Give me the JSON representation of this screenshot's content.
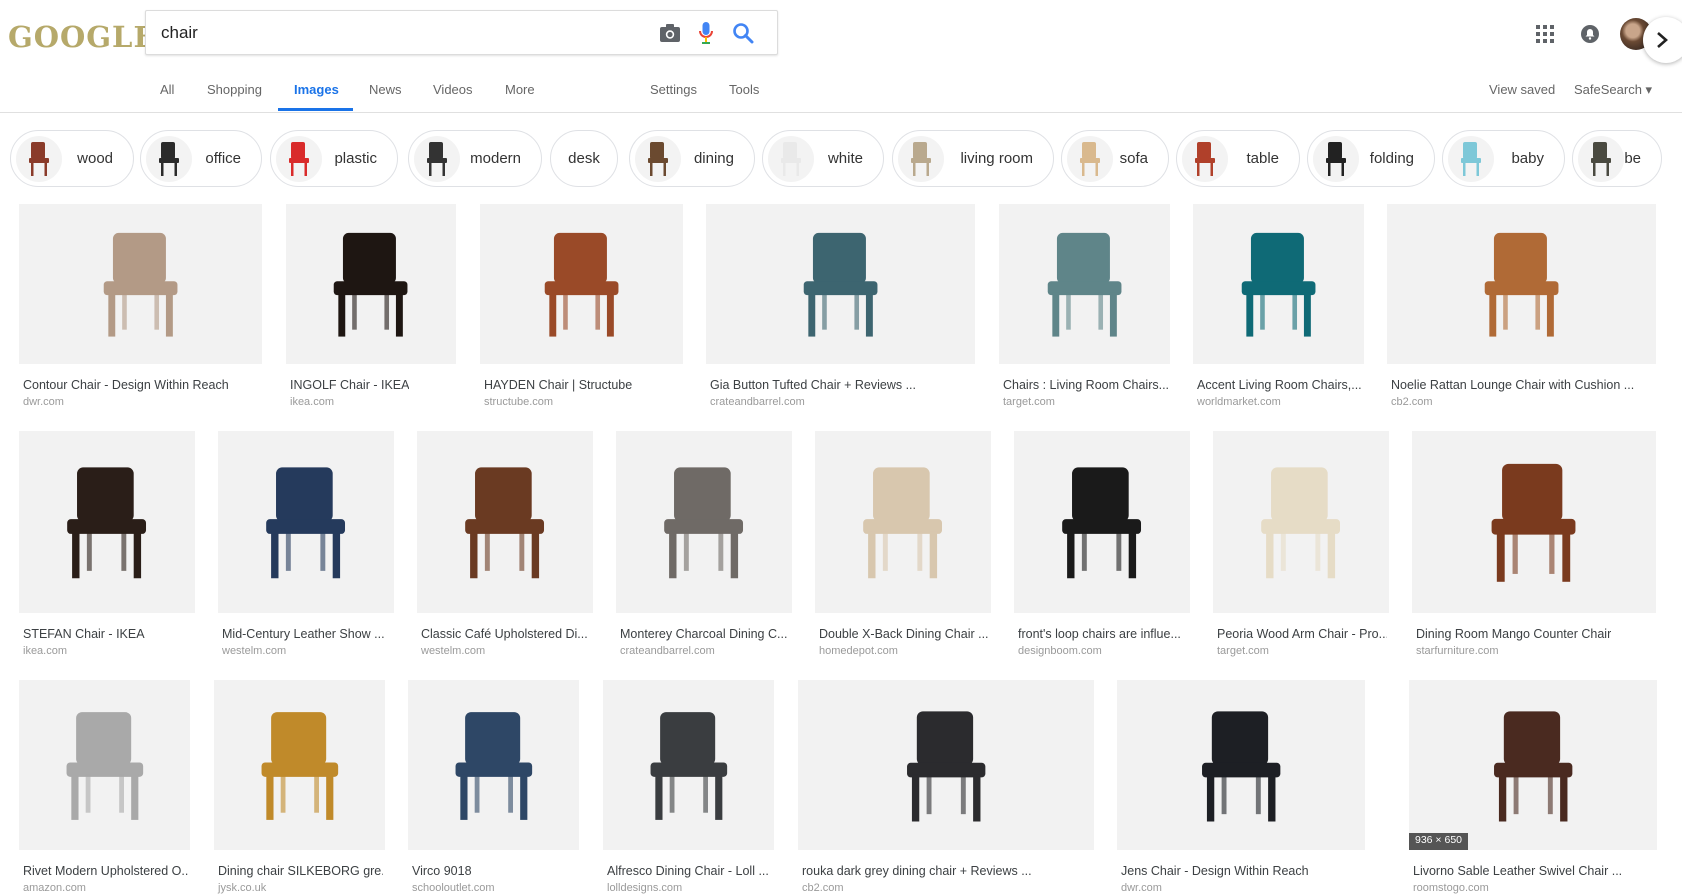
{
  "logo": "GOOGLE",
  "search": {
    "value": "chair",
    "placeholder": ""
  },
  "search_icons": [
    "camera-icon",
    "microphone-icon",
    "search-icon"
  ],
  "header_icons": [
    "apps-grid-icon",
    "notifications-icon",
    "account-avatar"
  ],
  "nav": {
    "tabs": [
      "All",
      "Shopping",
      "Images",
      "News",
      "Videos",
      "More"
    ],
    "active": "Images",
    "settings": "Settings",
    "tools": "Tools",
    "view_saved": "View saved",
    "safesearch": "SafeSearch ▾"
  },
  "chips": [
    {
      "label": "wood",
      "color": "#8a3b2a"
    },
    {
      "label": "office",
      "color": "#2b2b2b"
    },
    {
      "label": "plastic",
      "color": "#d92b2b"
    },
    {
      "label": "modern",
      "color": "#333333"
    },
    {
      "label": "desk",
      "color": ""
    },
    {
      "label": "dining",
      "color": "#6b4a30"
    },
    {
      "label": "white",
      "color": "#e9e9e9"
    },
    {
      "label": "living room",
      "color": "#b9a98e"
    },
    {
      "label": "sofa",
      "color": "#d9b98e"
    },
    {
      "label": "table",
      "color": "#b0402a"
    },
    {
      "label": "folding",
      "color": "#222222"
    },
    {
      "label": "baby",
      "color": "#7ec8d8"
    },
    {
      "label": "be",
      "color": "#4a4a40"
    }
  ],
  "results": [
    {
      "title": "Contour Chair - Design Within Reach",
      "source": "dwr.com",
      "color": "#b39a86"
    },
    {
      "title": "INGOLF Chair - IKEA",
      "source": "ikea.com",
      "color": "#1e1612"
    },
    {
      "title": "HAYDEN Chair | Structube",
      "source": "structube.com",
      "color": "#9a4a28"
    },
    {
      "title": "Gia Button Tufted Chair + Reviews ...",
      "source": "crateandbarrel.com",
      "color": "#3d6570"
    },
    {
      "title": "Chairs : Living Room Chairs...",
      "source": "target.com",
      "color": "#5f8589"
    },
    {
      "title": "Accent Living Room Chairs,...",
      "source": "worldmarket.com",
      "color": "#0f6a76"
    },
    {
      "title": "Noelie Rattan Lounge Chair with Cushion ...",
      "source": "cb2.com",
      "color": "#b06a36"
    },
    {
      "title": "STEFAN Chair - IKEA",
      "source": "ikea.com",
      "color": "#2a1e18"
    },
    {
      "title": "Mid-Century Leather Show ...",
      "source": "westelm.com",
      "color": "#253a5c"
    },
    {
      "title": "Classic Café Upholstered Di...",
      "source": "westelm.com",
      "color": "#6a3a22"
    },
    {
      "title": "Monterey Charcoal Dining C...",
      "source": "crateandbarrel.com",
      "color": "#6f6a66"
    },
    {
      "title": "Double X-Back Dining Chair ...",
      "source": "homedepot.com",
      "color": "#d8c7ae"
    },
    {
      "title": "front's loop chairs are influe...",
      "source": "designboom.com",
      "color": "#1a1a1a"
    },
    {
      "title": "Peoria Wood Arm Chair - Pro...",
      "source": "target.com",
      "color": "#e6dcc6"
    },
    {
      "title": "Dining Room Mango Counter Chair",
      "source": "starfurniture.com",
      "color": "#7a3a1e"
    },
    {
      "title": "Rivet Modern Upholstered O...",
      "source": "amazon.com",
      "color": "#a9a9a9"
    },
    {
      "title": "Dining chair SILKEBORG gre...",
      "source": "jysk.co.uk",
      "color": "#c08a2a"
    },
    {
      "title": "Virco 9018",
      "source": "schooloutlet.com",
      "color": "#2e4766"
    },
    {
      "title": "Alfresco Dining Chair - Loll ...",
      "source": "lolldesigns.com",
      "color": "#3a3d40"
    },
    {
      "title": "rouka dark grey dining chair + Reviews ...",
      "source": "cb2.com",
      "color": "#2b2b2e"
    },
    {
      "title": "Jens Chair - Design Within Reach",
      "source": "dwr.com",
      "color": "#1d1f24"
    },
    {
      "title": "Livorno Sable Leather Swivel Chair ...",
      "source": "roomstogo.com",
      "color": "#4a2a20",
      "dims": "936 × 650"
    }
  ]
}
